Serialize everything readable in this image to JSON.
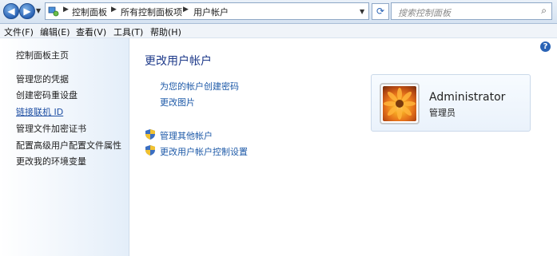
{
  "addressbar": {
    "breadcrumbs": [
      "控制面板",
      "所有控制面板项",
      "用户帐户"
    ],
    "search_placeholder": "搜索控制面板",
    "back_icon": "back-arrow-icon",
    "forward_icon": "forward-arrow-icon",
    "refresh_icon": "refresh-icon",
    "search_icon": "search-icon"
  },
  "menubar": {
    "items": [
      "文件(F)",
      "编辑(E)",
      "查看(V)",
      "工具(T)",
      "帮助(H)"
    ]
  },
  "sidebar": {
    "items": [
      {
        "label": "控制面板主页"
      },
      {
        "label": "管理您的凭据"
      },
      {
        "label": "创建密码重设盘"
      },
      {
        "label": "链接联机 ID"
      },
      {
        "label": "管理文件加密证书"
      },
      {
        "label": "配置高级用户配置文件属性"
      },
      {
        "label": "更改我的环境变量"
      }
    ]
  },
  "main": {
    "title": "更改用户帐户",
    "links": [
      "为您的帐户创建密码",
      "更改图片"
    ],
    "admin_links": [
      "管理其他帐户",
      "更改用户帐户控制设置"
    ],
    "help_label": "?"
  },
  "account": {
    "name": "Administrator",
    "role": "管理员"
  },
  "colors": {
    "link": "#1e5aa8",
    "title": "#1e3a8a",
    "sidebar_bg": "#e4eef9"
  }
}
